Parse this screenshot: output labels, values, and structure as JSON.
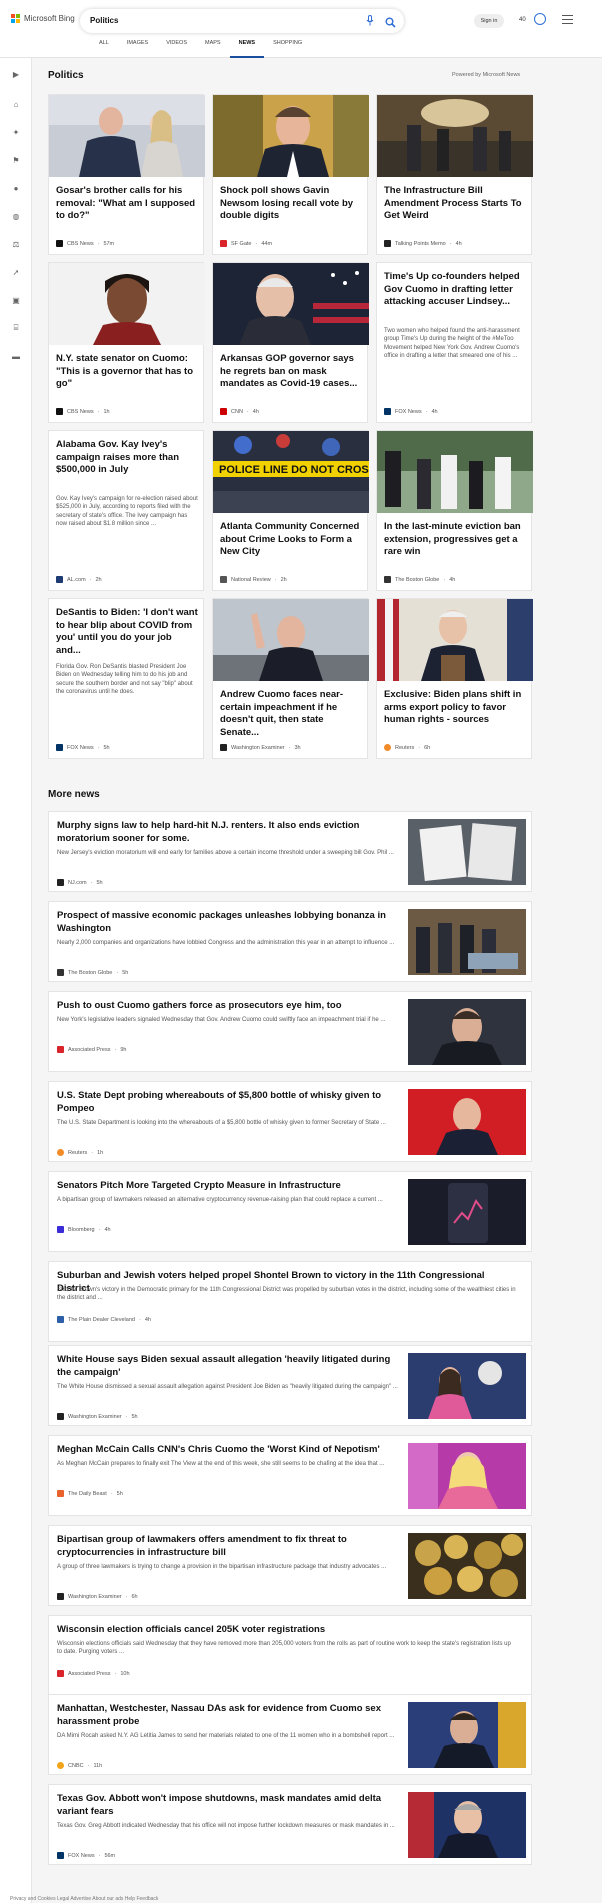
{
  "header": {
    "logo_text": "Microsoft Bing",
    "search_value": "Politics",
    "tabs": [
      "ALL",
      "IMAGES",
      "VIDEOS",
      "MAPS",
      "NEWS",
      "SHOPPING"
    ],
    "active_tab": "NEWS",
    "sign_in": "Sign in",
    "points": "40"
  },
  "section": {
    "title": "Politics",
    "powered_by": "Powered by Microsoft News"
  },
  "cards": [
    {
      "title": "Gosar's brother calls for his removal: \"What am I supposed to do?\"",
      "snippet": "",
      "source": "CBS News",
      "time": "57m",
      "icon_color": "#111111"
    },
    {
      "title": "Shock poll shows Gavin Newsom losing recall vote by double digits",
      "snippet": "",
      "source": "SF Gate",
      "time": "44m",
      "icon_color": "#d9242b"
    },
    {
      "title": "The Infrastructure Bill Amendment Process Starts To Get Weird",
      "snippet": "",
      "source": "Talking Points Memo",
      "time": "4h",
      "icon_color": "#222222"
    },
    {
      "title": "N.Y. state senator on Cuomo: \"This is a governor that has to go\"",
      "snippet": "",
      "source": "CBS News",
      "time": "1h",
      "icon_color": "#111111"
    },
    {
      "title": "Arkansas GOP governor says he regrets ban on mask mandates as Covid-19 cases...",
      "snippet": "",
      "source": "CNN",
      "time": "4h",
      "icon_color": "#cc0000"
    },
    {
      "title": "Time's Up co-founders helped Gov Cuomo in drafting letter attacking accuser Lindsey...",
      "snippet": "Two women who helped found the anti-harassment group Time's Up during the height of the #MeToo Movement helped New York Gov. Andrew Cuomo's office in drafting a letter that smeared one of his ...",
      "source": "FOX News",
      "time": "4h",
      "icon_color": "#003366"
    },
    {
      "title": "Alabama Gov. Kay Ivey's campaign raises more than $500,000 in July",
      "snippet": "Gov. Kay Ivey's campaign for re-election raised about $525,000 in July, according to reports filed with the secretary of state's office. The Ivey campaign has now raised about $1.8 million since ...",
      "source": "AL.com",
      "time": "2h",
      "icon_color": "#1f3b73"
    },
    {
      "title": "Atlanta Community Concerned about Crime Looks to Form a New City",
      "snippet": "",
      "source": "National Review",
      "time": "2h",
      "icon_color": "#555555"
    },
    {
      "title": "In the last-minute eviction ban extension, progressives get a rare win",
      "snippet": "",
      "source": "The Boston Globe",
      "time": "4h",
      "icon_color": "#333333"
    },
    {
      "title": "DeSantis to Biden: 'I don't want to hear blip about COVID from you' until you do your job and...",
      "snippet": "Florida Gov. Ron DeSantis blasted President Joe Biden on Wednesday telling him to do his job and secure the southern border and not say \"blip\" about the coronavirus until he does.",
      "source": "FOX News",
      "time": "5h",
      "icon_color": "#003366"
    },
    {
      "title": "Andrew Cuomo faces near-certain impeachment if he doesn't quit, then state Senate...",
      "snippet": "",
      "source": "Washington Examiner",
      "time": "3h",
      "icon_color": "#222222"
    },
    {
      "title": "Exclusive: Biden plans shift in arms export policy to favor human rights - sources",
      "snippet": "",
      "source": "Reuters",
      "time": "6h",
      "icon_color": "#f28c28"
    }
  ],
  "more_news": {
    "title": "More news",
    "items": [
      {
        "title": "Murphy signs law to help hard-hit N.J. renters. It also ends eviction moratorium sooner for some.",
        "snippet": "New Jersey's eviction moratorium will end early for families above a certain income threshold under a sweeping bill Gov. Phil ...",
        "source": "NJ.com",
        "time": "5h",
        "icon_color": "#222222"
      },
      {
        "title": "Prospect of massive economic packages unleashes lobbying bonanza in Washington",
        "snippet": "Nearly 2,000 companies and organizations have lobbied Congress and the administration this year in an attempt to influence ...",
        "source": "The Boston Globe",
        "time": "5h",
        "icon_color": "#333333"
      },
      {
        "title": "Push to oust Cuomo gathers force as prosecutors eye him, too",
        "snippet": "New York's legislative leaders signaled Wednesday that Gov. Andrew Cuomo could swiftly face an impeachment trial if he ...",
        "source": "Associated Press",
        "time": "9h",
        "icon_color": "#d9242b"
      },
      {
        "title": "U.S. State Dept probing whereabouts of $5,800 bottle of whisky given to Pompeo",
        "snippet": "The U.S. State Department is looking into the whereabouts of a $5,800 bottle of whisky given to former Secretary of State ...",
        "source": "Reuters",
        "time": "1h",
        "icon_color": "#f28c28"
      },
      {
        "title": "Senators Pitch More Targeted Crypto Measure in Infrastructure",
        "snippet": "A bipartisan group of lawmakers released an alternative cryptocurrency revenue-raising plan that could replace a current ...",
        "source": "Bloomberg",
        "time": "4h",
        "icon_color": "#3a2cd6"
      },
      {
        "title": "Suburban and Jewish voters helped propel Shontel Brown to victory in the 11th Congressional District",
        "snippet": "Shontel Brown's victory in the Democratic primary for the 11th Congressional District was propelled by suburban votes in the district, including some of the wealthiest cities in the district and ...",
        "source": "The Plain Dealer Cleveland",
        "time": "4h",
        "icon_color": "#2b5fa8"
      },
      {
        "title": "White House says Biden sexual assault allegation 'heavily litigated during the campaign'",
        "snippet": "The White House dismissed a sexual assault allegation against President Joe Biden as \"heavily litigated during the campaign\" ...",
        "source": "Washington Examiner",
        "time": "5h",
        "icon_color": "#222222"
      },
      {
        "title": "Meghan McCain Calls CNN's Chris Cuomo the 'Worst Kind of Nepotism'",
        "snippet": "As Meghan McCain prepares to finally exit The View at the end of this week, she still seems to be chafing at the idea that ...",
        "source": "The Daily Beast",
        "time": "5h",
        "icon_color": "#e8632b"
      },
      {
        "title": "Bipartisan group of lawmakers offers amendment to fix threat to cryptocurrencies in infrastructure bill",
        "snippet": "A group of three lawmakers is trying to change a provision in the bipartisan infrastructure package that industry advocates ...",
        "source": "Washington Examiner",
        "time": "6h",
        "icon_color": "#222222"
      },
      {
        "title": "Wisconsin election officials cancel 205K voter registrations",
        "snippet": "Wisconsin elections officials said Wednesday that they have removed more than 205,000 voters from the rolls as part of routine work to keep the state's registration lists up to date. Purging voters ...",
        "source": "Associated Press",
        "time": "10h",
        "icon_color": "#d9242b"
      },
      {
        "title": "Manhattan, Westchester, Nassau DAs ask for evidence from Cuomo sex harassment probe",
        "snippet": "DA Mimi Rocah asked N.Y. AG Letitia James to send her materials related to one of the 11 women who in a bombshell report ...",
        "source": "CNBC",
        "time": "11h",
        "icon_color": "#f2a41b"
      },
      {
        "title": "Texas Gov. Abbott won't impose shutdowns, mask mandates amid delta variant fears",
        "snippet": "Texas Gov. Greg Abbott indicated Wednesday that his office will not impose further lockdown measures or mask mandates in ...",
        "source": "FOX News",
        "time": "56m",
        "icon_color": "#003366"
      }
    ]
  },
  "footer": {
    "text": "Privacy and Cookies   Legal   Advertise   About our ads   Help   Feedback"
  }
}
